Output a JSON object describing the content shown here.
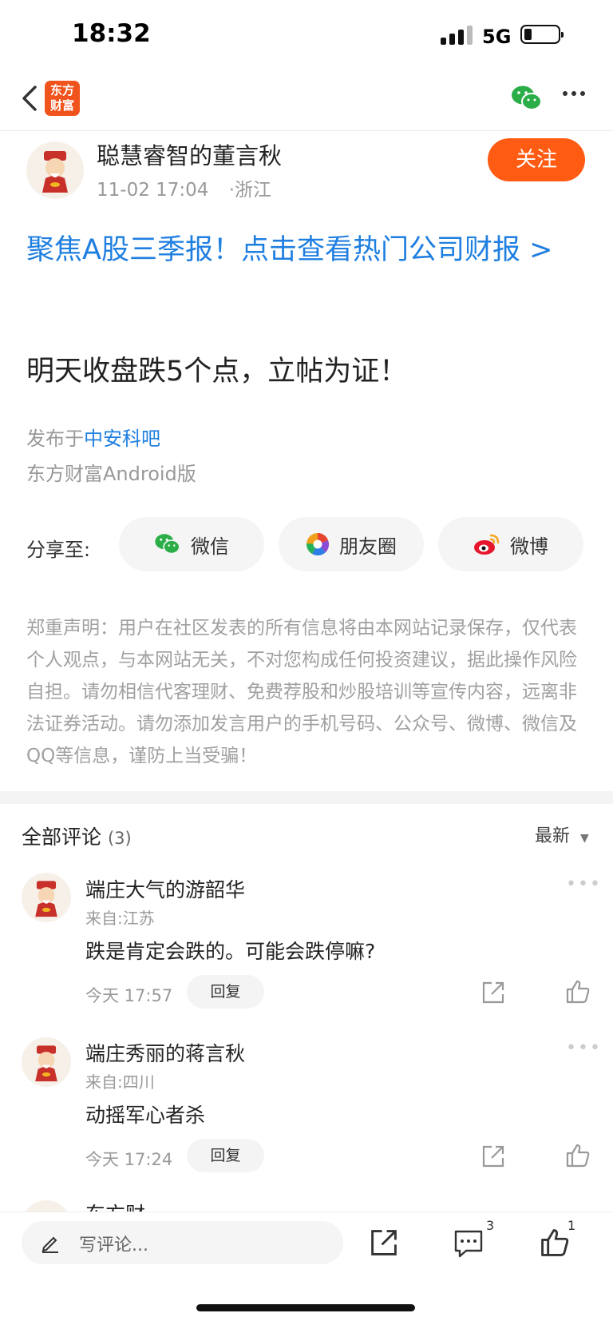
{
  "status_bar": {
    "time": "18:32",
    "network": "5G"
  },
  "nav": {
    "logo_line1": "东方",
    "logo_line2": "财富"
  },
  "post": {
    "author_name": "聪慧睿智的董言秋",
    "time": "11-02 17:04",
    "location": "·浙江",
    "follow_label": "关注",
    "promo_text": "聚焦A股三季报！点击查看热门公司财报 >",
    "title": "明天收盘跌5个点，立帖为证！",
    "published_prefix": "发布于",
    "bar_name": "中安科吧",
    "client": "东方财富Android版"
  },
  "share": {
    "label": "分享至:",
    "items": [
      {
        "label": "微信",
        "icon": "wechat-icon"
      },
      {
        "label": "朋友圈",
        "icon": "moments-icon"
      },
      {
        "label": "微博",
        "icon": "weibo-icon"
      }
    ]
  },
  "disclaimer": "郑重声明：用户在社区发表的所有信息将由本网站记录保存，仅代表个人观点，与本网站无关，不对您构成任何投资建议，据此操作风险自担。请勿相信代客理财、免费荐股和炒股培训等宣传内容，远离非法证券活动。请勿添加发言用户的手机号码、公众号、微博、微信及QQ等信息，谨防上当受骗！",
  "comments_header": {
    "title": "全部评论",
    "count": "(3)",
    "sort_label": "最新"
  },
  "comments": [
    {
      "name": "端庄大气的游韶华",
      "from": "来自:江苏",
      "text": "跌是肯定会跌的。可能会跌停嘛?",
      "time": "今天 17:57",
      "reply_label": "回复"
    },
    {
      "name": "端庄秀丽的蒋言秋",
      "from": "来自:四川",
      "text": "动摇军心者杀",
      "time": "今天 17:24",
      "reply_label": "回复"
    },
    {
      "name": "东方财"
    }
  ],
  "bottom_bar": {
    "write_placeholder": "写评论...",
    "comment_count": "3",
    "like_count": "1"
  },
  "colors": {
    "accent_orange": "#ff5b12",
    "link_blue": "#1f7fe0",
    "brand_logo": "#f1531d"
  }
}
